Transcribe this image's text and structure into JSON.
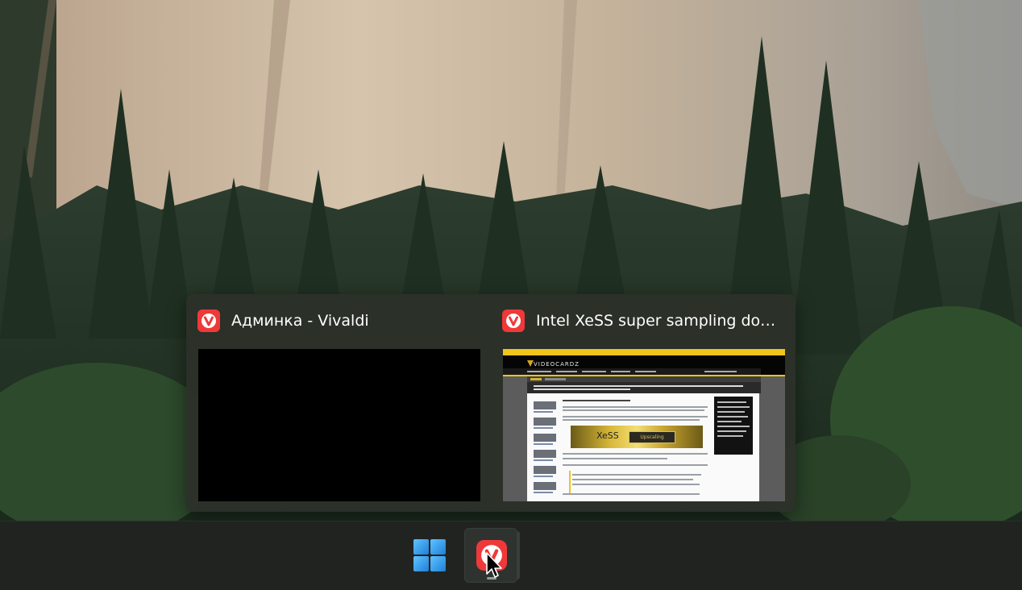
{
  "taskbar": {
    "start": {
      "icon": "windows-logo-icon"
    },
    "pinned_apps": [
      {
        "name": "Vivaldi",
        "icon": "vivaldi-icon",
        "running": true,
        "window_count": 2
      }
    ]
  },
  "preview": {
    "windows": [
      {
        "title": "Админка - Vivaldi",
        "icon": "vivaldi-icon",
        "content": "blank"
      },
      {
        "title": "Intel XeSS super sampling doe...",
        "icon": "vivaldi-icon",
        "content": "webpage",
        "thumbnail": {
          "site_logo": "VIDEOCARDZ",
          "banner_text": "XeSS",
          "banner_button": "Upscaling"
        }
      }
    ]
  },
  "colors": {
    "vivaldi_red": "#ef3939",
    "windows_blue": "#3aa0f0",
    "taskbar_bg": "#202320",
    "flyout_bg": "#2c302a"
  }
}
